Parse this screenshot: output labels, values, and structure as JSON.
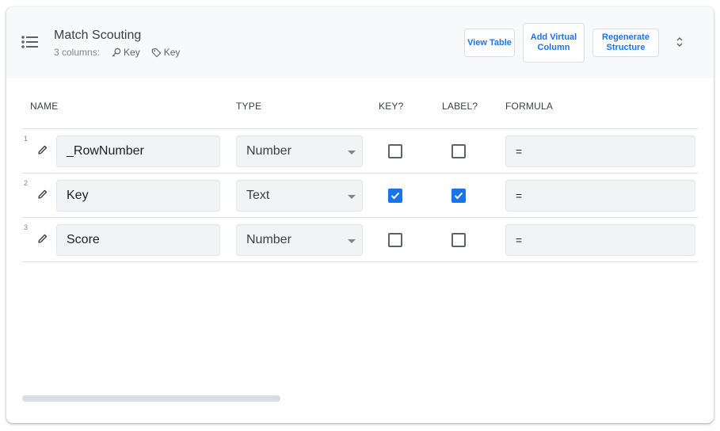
{
  "header": {
    "title": "Match Scouting",
    "columns_count": "3 columns:",
    "key_chip": "Key",
    "label_chip": "Key",
    "buttons": {
      "view_table": "View Table",
      "add_virtual_column": "Add Virtual Column",
      "regenerate_structure": "Regenerate Structure"
    }
  },
  "table": {
    "headers": {
      "name": "NAME",
      "type": "TYPE",
      "key": "KEY?",
      "label": "LABEL?",
      "formula": "FORMULA"
    },
    "rows": [
      {
        "num": "1",
        "name": "_RowNumber",
        "type": "Number",
        "key": false,
        "label": false,
        "formula": "="
      },
      {
        "num": "2",
        "name": "Key",
        "type": "Text",
        "key": true,
        "label": true,
        "formula": "="
      },
      {
        "num": "3",
        "name": "Score",
        "type": "Number",
        "key": false,
        "label": false,
        "formula": "="
      }
    ]
  },
  "colors": {
    "accent": "#1a73e8",
    "header_bg": "#f8f9fa",
    "field_bg": "#f1f3f4"
  }
}
